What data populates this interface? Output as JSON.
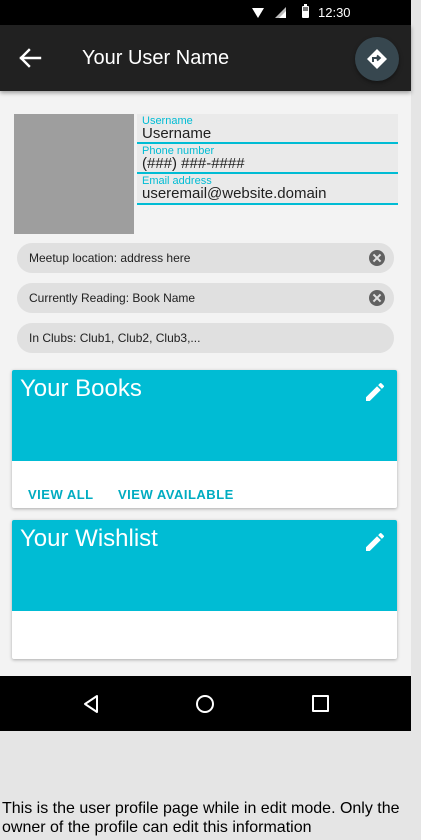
{
  "status_bar": {
    "time": "12:30"
  },
  "app_bar": {
    "title": "Your User Name"
  },
  "profile": {
    "username": {
      "label": "Username",
      "value": "Username"
    },
    "phone": {
      "label": "Phone number",
      "value": "(###) ###-####"
    },
    "email": {
      "label": "Email address",
      "value": "useremail@website.domain"
    }
  },
  "chips": [
    {
      "text": "Meetup location: address here"
    },
    {
      "text": "Currently Reading: Book Name"
    },
    {
      "text": "In Clubs: Club1, Club2, Club3,..."
    }
  ],
  "cards": {
    "books": {
      "title": "Your Books",
      "actions": [
        "VIEW ALL",
        "VIEW AVAILABLE"
      ]
    },
    "wishlist": {
      "title": "Your Wishlist"
    }
  },
  "caption": "This is the user profile page while in edit mode. Only the owner of the profile can edit this information",
  "colors": {
    "accent": "#00bcd4",
    "app_bar": "#212121",
    "fab": "#37474f"
  },
  "icons": [
    "back-arrow-icon",
    "directions-icon",
    "clear-icon",
    "edit-pencil-icon",
    "nav-back-icon",
    "nav-home-icon",
    "nav-recents-icon"
  ]
}
